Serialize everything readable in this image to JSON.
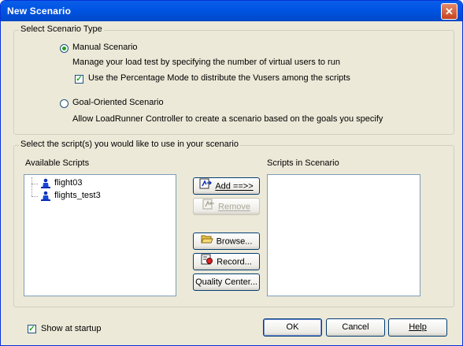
{
  "window": {
    "title": "New Scenario",
    "close_glyph": "✕"
  },
  "scenario_type": {
    "legend": "Select Scenario Type",
    "manual_label": "Manual Scenario",
    "manual_selected": true,
    "manual_desc": "Manage your load test by specifying the number of virtual users to run",
    "percentage_mode_label": "Use the Percentage Mode to distribute the Vusers among the scripts",
    "percentage_mode_checked": true,
    "goal_label": "Goal-Oriented Scenario",
    "goal_selected": false,
    "goal_desc": "Allow LoadRunner Controller to create a scenario based on the goals you specify"
  },
  "scripts": {
    "legend": "Select the script(s) you would like to use in your scenario",
    "available_label": "Available Scripts",
    "in_scenario_label": "Scripts in Scenario",
    "available_items": [
      "flight03",
      "flights_test3"
    ],
    "item_icon": "vuser-script-icon",
    "buttons": {
      "add": "Add ==>>",
      "remove": "Remove",
      "browse": "Browse...",
      "record": "Record...",
      "quality_center": "Quality Center..."
    }
  },
  "footer": {
    "show_at_startup": "Show at startup",
    "show_at_startup_checked": true,
    "ok": "OK",
    "cancel": "Cancel",
    "help": "Help"
  },
  "colors": {
    "titlebar": "#0054e3",
    "face": "#ece9d8",
    "accent_check": "#21a121"
  }
}
